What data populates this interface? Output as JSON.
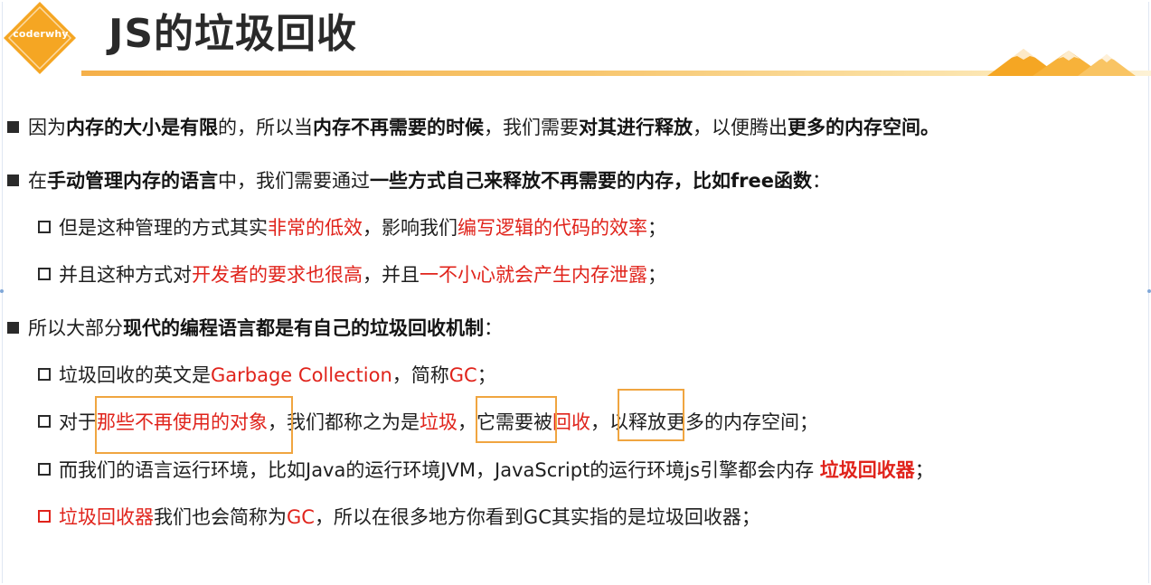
{
  "logo": {
    "text": "coderwhy",
    "color": "#f5a623"
  },
  "title": "JS的垃圾回收",
  "colors": {
    "accent": "#f5a623",
    "highlight_red": "#e0231b",
    "box_orange": "#f0a540"
  },
  "lines": {
    "l1": {
      "t1": "因为",
      "b1": "内存的大小是有限",
      "t2": "的，所以当",
      "b2": "内存不再需要的时候",
      "t3": "，我们需要",
      "b3": "对其进行释放",
      "t4": "，以便腾出",
      "b4": "更多的内存空间。"
    },
    "l2": {
      "t1": "在",
      "b1": "手动管理内存的语言",
      "t2": "中，我们需要通过",
      "b2": "一些方式自己来释放不再需要的内存，比如free函数",
      "t3": "："
    },
    "l3": {
      "t1": "但是这种管理的方式其实",
      "r1": "非常的低效",
      "t2": "，影响我们",
      "r2": "编写逻辑的代码的效率",
      "t3": "；"
    },
    "l4": {
      "t1": "并且这种方式对",
      "r1": "开发者的要求也很高",
      "t2": "，并且",
      "r2": "一不小心就会产生内存泄露",
      "t3": "；"
    },
    "l5": {
      "t1": "所以大部分",
      "b1": "现代的编程语言都是有自己的垃圾回收机制",
      "t2": "："
    },
    "l6": {
      "t1": "垃圾回收的英文是",
      "r1": "Garbage Collection",
      "t2": "，简称",
      "r2": "GC",
      "t3": "；"
    },
    "l7": {
      "t1": "对于",
      "r1": "那些不再使用的对象",
      "t2": "，我们都称之为是",
      "r2": "垃圾",
      "t3": "，它需要被",
      "r3": "回收",
      "t4": "，以释放更多的内存空间；"
    },
    "l8": {
      "t1": "而我们的语言运行环境，比如Java的运行环境JVM，JavaScript的运行环境js引擎都会内存 ",
      "rb1": "垃圾回收器",
      "t2": "；"
    },
    "l9": {
      "r1": "垃圾回收器",
      "t1": "我们也会简称为",
      "r2": "GC",
      "t2": "，所以在很多地方你看到GC其实指的是垃圾回收器；"
    }
  }
}
